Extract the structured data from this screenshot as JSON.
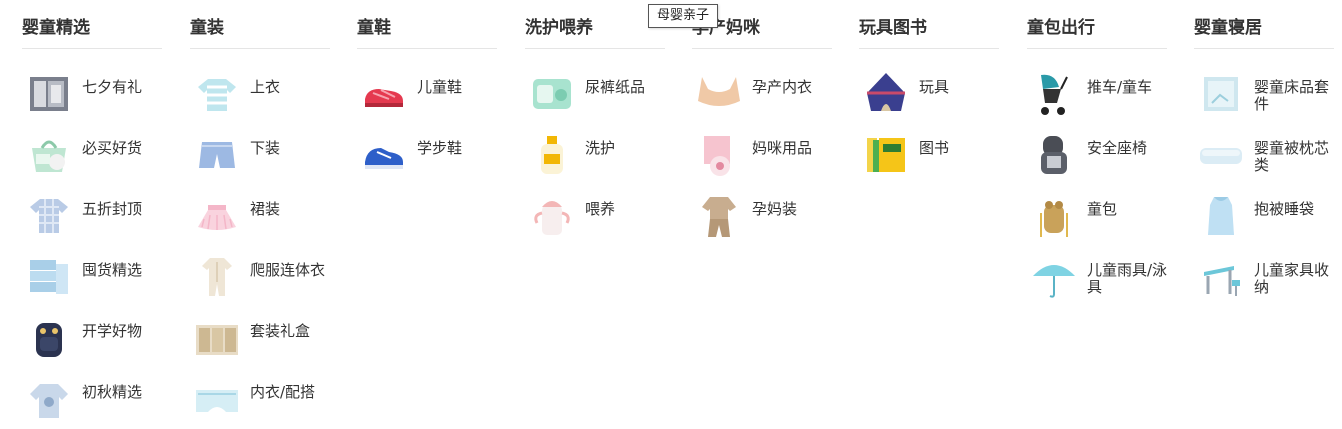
{
  "tooltip": "母婴亲子",
  "columns": [
    {
      "title": "婴童精选",
      "items": [
        {
          "label": "七夕有礼",
          "icon": "gift-box-icon"
        },
        {
          "label": "必买好货",
          "icon": "wipes-bag-icon"
        },
        {
          "label": "五折封顶",
          "icon": "plaid-shirt-icon"
        },
        {
          "label": "囤货精选",
          "icon": "tissue-stack-icon"
        },
        {
          "label": "开学好物",
          "icon": "school-backpack-icon"
        },
        {
          "label": "初秋精选",
          "icon": "sweatshirt-icon"
        }
      ]
    },
    {
      "title": "童装",
      "items": [
        {
          "label": "上衣",
          "icon": "striped-tshirt-icon"
        },
        {
          "label": "下装",
          "icon": "shorts-icon"
        },
        {
          "label": "裙装",
          "icon": "tutu-skirt-icon"
        },
        {
          "label": "爬服连体衣",
          "icon": "romper-icon"
        },
        {
          "label": "套装礼盒",
          "icon": "gift-set-box-icon"
        },
        {
          "label": "内衣/配搭",
          "icon": "underwear-icon"
        }
      ]
    },
    {
      "title": "童鞋",
      "items": [
        {
          "label": "儿童鞋",
          "icon": "red-sandal-icon"
        },
        {
          "label": "学步鞋",
          "icon": "blue-shoe-icon"
        }
      ]
    },
    {
      "title": "洗护喂养",
      "items": [
        {
          "label": "尿裤纸品",
          "icon": "diaper-pack-icon"
        },
        {
          "label": "洗护",
          "icon": "lotion-bottle-icon"
        },
        {
          "label": "喂养",
          "icon": "sippy-cup-icon"
        }
      ]
    },
    {
      "title": "孕产妈咪",
      "items": [
        {
          "label": "孕产内衣",
          "icon": "bra-icon"
        },
        {
          "label": "妈咪用品",
          "icon": "breast-pump-icon"
        },
        {
          "label": "孕妈装",
          "icon": "maternity-outfit-icon"
        }
      ]
    },
    {
      "title": "玩具图书",
      "items": [
        {
          "label": "玩具",
          "icon": "play-tent-icon"
        },
        {
          "label": "图书",
          "icon": "books-icon"
        }
      ]
    },
    {
      "title": "童包出行",
      "items": [
        {
          "label": "推车/童车",
          "icon": "stroller-icon"
        },
        {
          "label": "安全座椅",
          "icon": "car-seat-icon"
        },
        {
          "label": "童包",
          "icon": "kids-bag-icon"
        },
        {
          "label": "儿童雨具/泳具",
          "icon": "umbrella-icon"
        }
      ]
    },
    {
      "title": "婴童寝居",
      "items": [
        {
          "label": "婴童床品套件",
          "icon": "bedding-set-icon"
        },
        {
          "label": "婴童被枕芯类",
          "icon": "pillow-icon"
        },
        {
          "label": "抱被睡袋",
          "icon": "sleeping-bag-icon"
        },
        {
          "label": "儿童家具收纳",
          "icon": "kids-desk-icon"
        }
      ]
    }
  ]
}
